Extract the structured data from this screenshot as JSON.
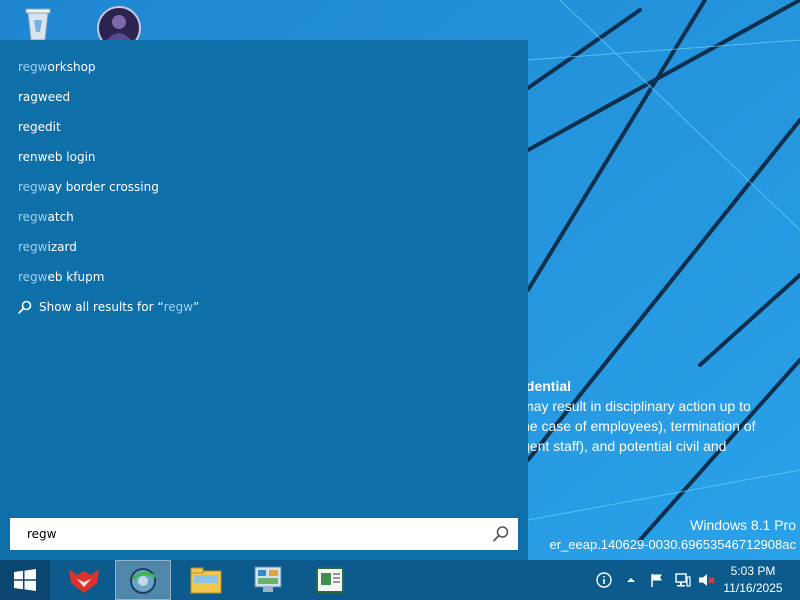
{
  "search": {
    "query": "regw",
    "suggestions": [
      {
        "match": "regw",
        "rest": "orkshop"
      },
      {
        "match": "",
        "rest": "ragweed"
      },
      {
        "match": "",
        "rest": "regedit"
      },
      {
        "match": "",
        "rest": "renweb login"
      },
      {
        "match": "regw",
        "rest": "ay border crossing"
      },
      {
        "match": "regw",
        "rest": "atch"
      },
      {
        "match": "regw",
        "rest": "izard"
      },
      {
        "match": "regw",
        "rest": "eb kfupm"
      }
    ],
    "show_all_prefix": "Show all results for “",
    "show_all_query": "regw",
    "show_all_suffix": "”"
  },
  "desktop": {
    "notice": {
      "title": "idential",
      "line1": "may result in disciplinary action up to",
      "line2": "he case of employees), termination of",
      "line3": "gent staff), and potential civil and"
    },
    "watermark_edition": "Windows 8.1 Pro",
    "watermark_build": "er_eeap.140629-0030.69653546712908ac"
  },
  "taskbar": {
    "time": "5:03 PM",
    "date": "11/16/2025"
  },
  "colors": {
    "panel": "#0f6fa8",
    "taskbar": "#0d5a8c",
    "match_text": "#9fd2f3",
    "desktop": "#1e8ad6"
  }
}
